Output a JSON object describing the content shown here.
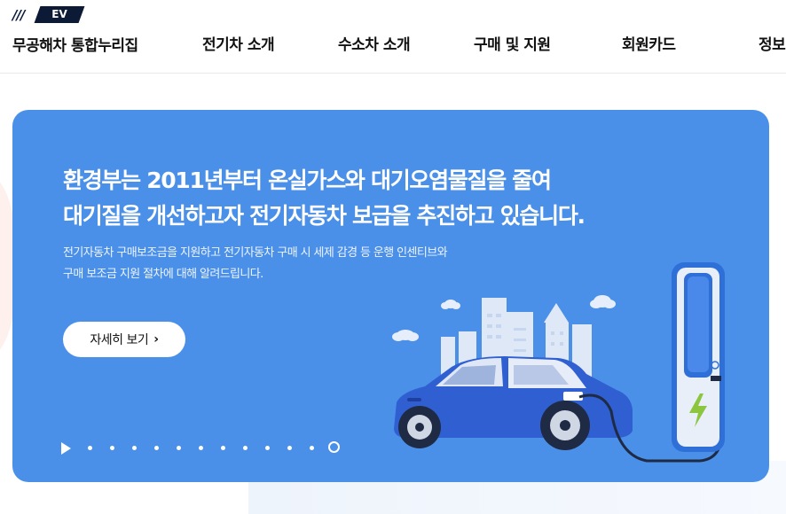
{
  "header": {
    "logo_slashes": "///",
    "logo_badge": "EV",
    "site_title": "무공해차 통합누리집",
    "nav": [
      {
        "label": "전기차 소개"
      },
      {
        "label": "수소차 소개"
      },
      {
        "label": "구매 및 지원"
      },
      {
        "label": "회원카드"
      },
      {
        "label": "정보"
      }
    ]
  },
  "hero": {
    "title_line1": "환경부는 2011년부터 온실가스와 대기오염물질을 줄여",
    "title_line2": "대기질을 개선하고자 전기자동차 보급을 추진하고 있습니다.",
    "desc_line1": "전기자동차 구매보조금을 지원하고 전기자동차 구매 시 세제 감경 등 운행 인센티브와",
    "desc_line2": "구매 보조금 지원 절차에 대해 알려드립니다.",
    "button_label": "자세히 보기",
    "button_icon": "chevron-right-icon",
    "slide_count": 12,
    "active_slide": 12
  },
  "colors": {
    "hero_bg": "#4a90e8",
    "car_body": "#2f5fd0",
    "charger_body": "#2f6fd8",
    "bolt": "#8cc63f"
  }
}
